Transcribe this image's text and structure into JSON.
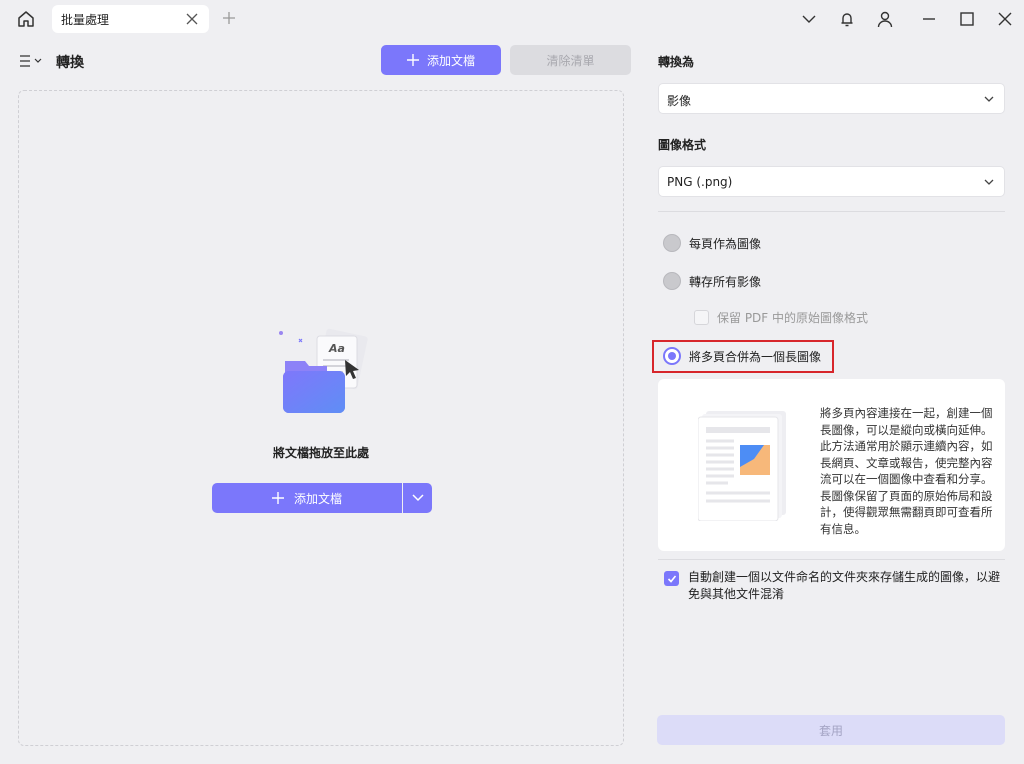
{
  "tab": {
    "title": "批量處理"
  },
  "left": {
    "title": "轉換",
    "add_button": "添加文檔",
    "clear_button": "清除清單",
    "drop_text": "將文檔拖放至此處",
    "main_add_button": "添加文檔"
  },
  "right": {
    "convert_to_label": "轉換為",
    "convert_to_value": "影像",
    "format_label": "圖像格式",
    "format_value": "PNG (.png)",
    "options": {
      "each_page": "每頁作為圖像",
      "save_all": "轉存所有影像",
      "keep_format": "保留 PDF 中的原始圖像格式",
      "merge_long": "將多頁合併為一個長圖像"
    },
    "selected_option": "merge_long",
    "description": "將多頁內容連接在一起，創建一個長圖像，可以是縱向或橫向延伸。此方法通常用於顯示連續內容，如長網頁、文章或報告，使完整內容流可以在一個圖像中查看和分享。長圖像保留了頁面的原始佈局和設計，使得觀眾無需翻頁即可查看所有信息。",
    "auto_folder": "自動創建一個以文件命名的文件夾來存儲生成的圖像，以避免與其他文件混淆",
    "auto_folder_checked": true,
    "apply_button": "套用"
  },
  "colors": {
    "accent": "#7b77fb",
    "highlight": "#d7262b",
    "disabled": "#dcdce0"
  }
}
